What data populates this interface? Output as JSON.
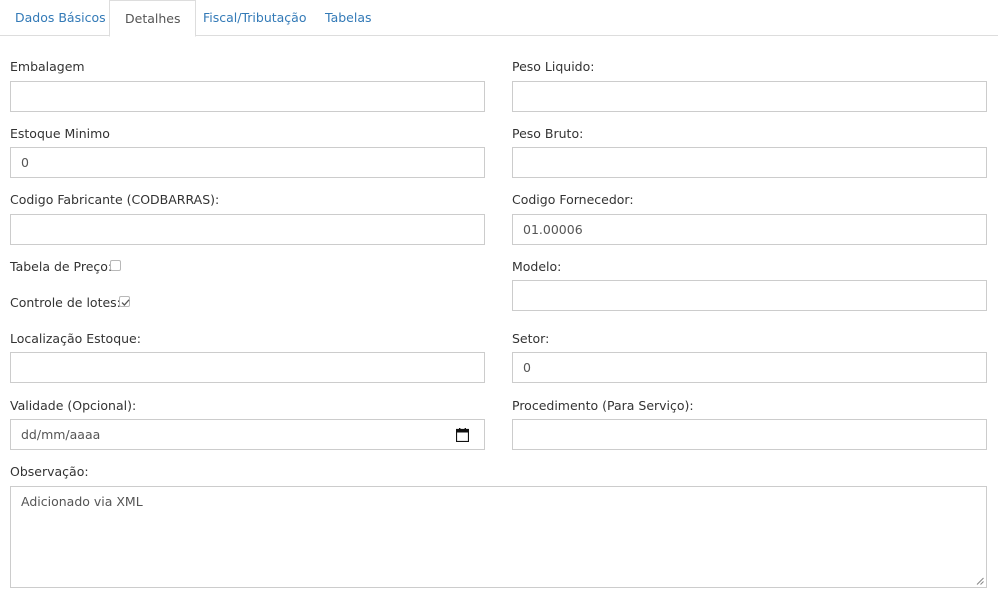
{
  "tabs": [
    {
      "label": "Dados Básicos"
    },
    {
      "label": "Detalhes"
    },
    {
      "label": "Fiscal/Tributação"
    },
    {
      "label": "Tabelas"
    }
  ],
  "form": {
    "embalagem": {
      "label": "Embalagem",
      "value": ""
    },
    "peso_liquido": {
      "label": "Peso Liquido:",
      "value": ""
    },
    "estoque_minimo": {
      "label": "Estoque Minimo",
      "value": "0"
    },
    "peso_bruto": {
      "label": "Peso Bruto:",
      "value": ""
    },
    "codigo_fabricante": {
      "label": "Codigo Fabricante (CODBARRAS):",
      "value": ""
    },
    "codigo_fornecedor": {
      "label": "Codigo Fornecedor:",
      "value": "01.00006"
    },
    "tabela_preco": {
      "label": "Tabela de Preço:",
      "checked": false
    },
    "modelo": {
      "label": "Modelo:",
      "value": ""
    },
    "controle_lotes": {
      "label": "Controle de lotes:",
      "checked": true
    },
    "localizacao_estoque": {
      "label": "Localização Estoque:",
      "value": ""
    },
    "setor": {
      "label": "Setor:",
      "value": "0"
    },
    "validade": {
      "label": "Validade (Opcional):",
      "placeholder": "dd/mm/aaaa"
    },
    "procedimento": {
      "label": "Procedimento (Para Serviço):",
      "value": ""
    },
    "observacao": {
      "label": "Observação:",
      "value": "Adicionado via XML"
    }
  }
}
